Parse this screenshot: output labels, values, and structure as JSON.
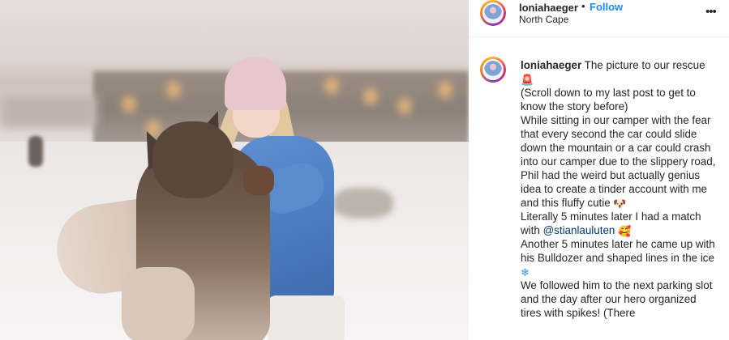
{
  "post": {
    "username": "loniahaeger",
    "follow_label": "Follow",
    "separator": "•",
    "location": "North Cape",
    "more_label": "•••"
  },
  "caption": {
    "username": "loniahaeger",
    "line1": "The picture to our rescue",
    "emoji_siren": "🚨",
    "para2": "(Scroll down to my last post to get to know the story before)",
    "para3": "While sitting in our camper with the fear that every second the car could slide down the mountain or a car could crash into our camper due to the slippery road, Phil had the weird but actually genius idea to create a tinder account with me and this fluffy cutie",
    "emoji_dog": "🐶",
    "para4_prefix": "Literally 5 minutes later I had a match with",
    "mention": "@stianlauluten",
    "emoji_smile": "🥰",
    "para5": "Another 5 minutes later he came up with his Bulldozer and shaped lines in the ice",
    "emoji_snow": "❄",
    "para6": "We followed him to the next parking slot and the day after our hero organized tires with spikes! (There"
  }
}
